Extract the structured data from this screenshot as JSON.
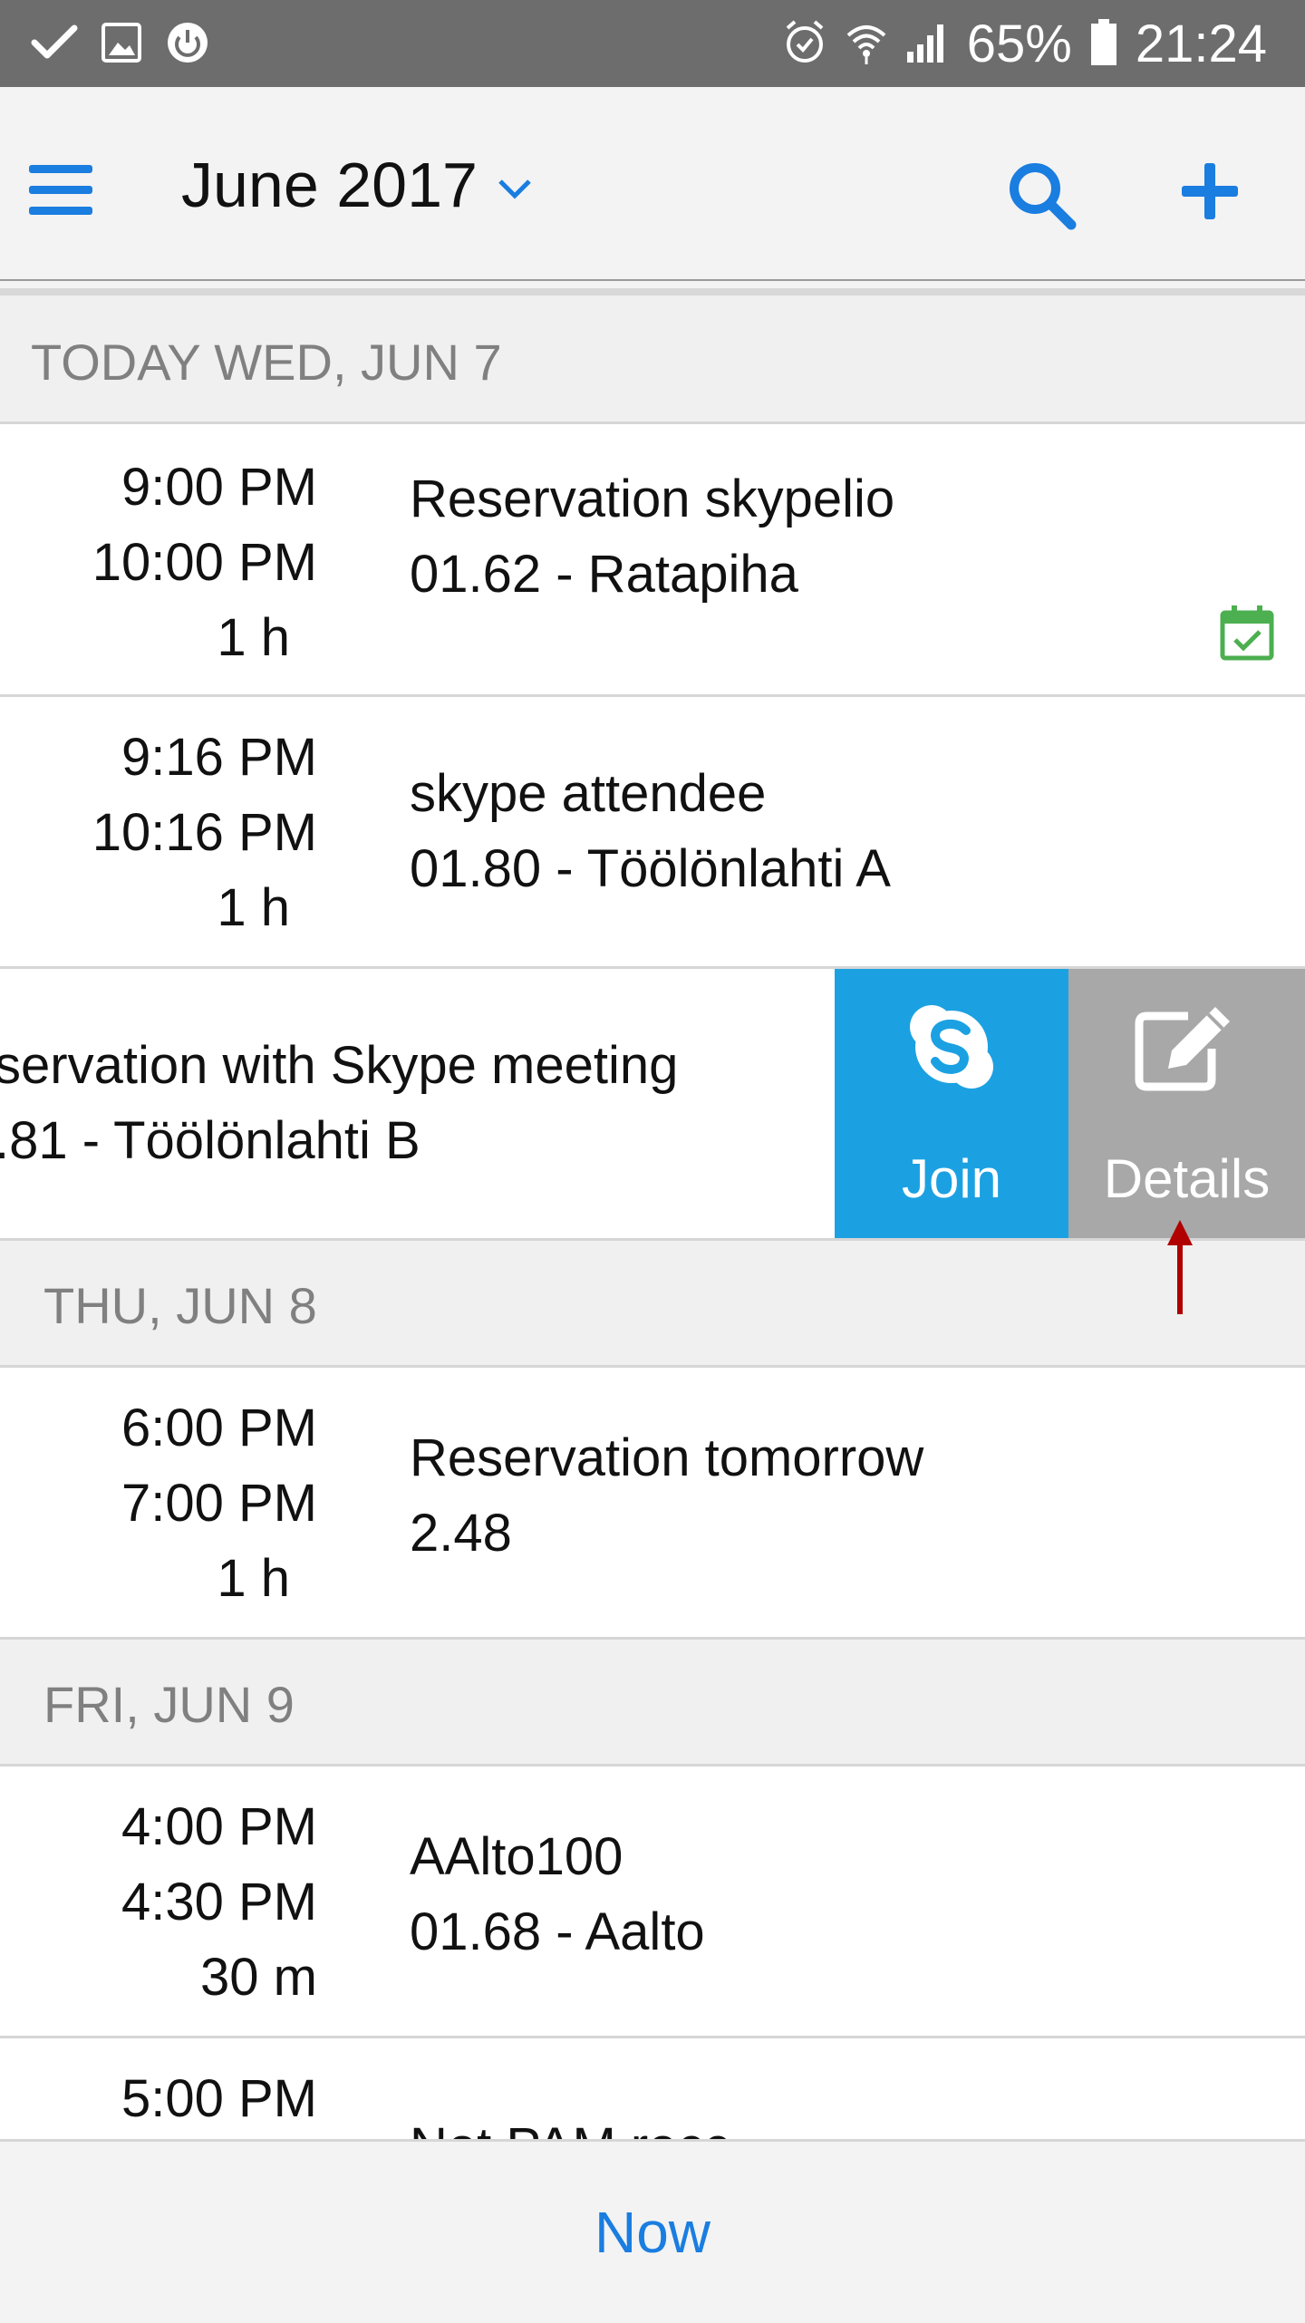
{
  "status_bar": {
    "battery": "65%",
    "time": "21:24",
    "left_icons": [
      "check-icon",
      "image-icon",
      "power-icon"
    ],
    "right_icons": [
      "alarm-icon",
      "wifi-icon",
      "signal-icon",
      "battery-icon"
    ]
  },
  "header": {
    "title": "June 2017",
    "icons": [
      "menu-icon",
      "chevron-down-icon",
      "search-icon",
      "plus-icon"
    ]
  },
  "days": [
    {
      "label": "TODAY WED, JUN 7",
      "events": [
        {
          "start": "9:00 PM",
          "end": "10:00 PM",
          "duration": "1 h",
          "title": "Reservation skypelio",
          "location": "01.62 - Ratapiha",
          "icon": "calendar-check-icon"
        },
        {
          "start": "9:16 PM",
          "end": "10:16 PM",
          "duration": "1 h",
          "title": "skype attendee",
          "location": "01.80 - Töölönlahti A"
        },
        {
          "title": "servation with Skype meeting",
          "location": ".81 - Töölönlahti B",
          "swiped": true
        }
      ]
    },
    {
      "label": "THU, JUN 8",
      "events": [
        {
          "start": "6:00 PM",
          "end": "7:00 PM",
          "duration": "1 h",
          "title": "Reservation tomorrow",
          "location": "2.48"
        }
      ]
    },
    {
      "label": "FRI, JUN 9",
      "events": [
        {
          "start": "4:00 PM",
          "end": "4:30 PM",
          "duration": "30 m",
          "title": "AAlto100",
          "location": "01.68 - Aalto"
        },
        {
          "start": "5:00 PM",
          "title": "Not PAM recc"
        }
      ]
    }
  ],
  "swipe_actions": {
    "join_label": "Join",
    "details_label": "Details",
    "join_icon": "skype-icon",
    "details_icon": "edit-icon",
    "join_color": "#1ba1e2",
    "details_color": "#a8a8a8"
  },
  "bottom_bar": {
    "now_label": "Now"
  },
  "colors": {
    "accent": "#1a7de0",
    "status_bar": "#6d6d6d",
    "calendar_check": "#4caf50",
    "annotation_arrow": "#b00000"
  }
}
